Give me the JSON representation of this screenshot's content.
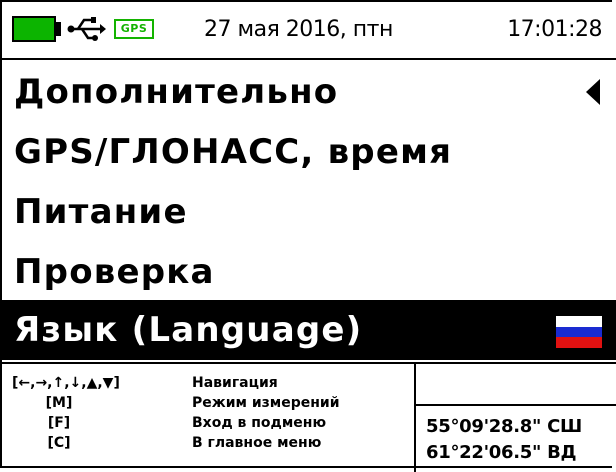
{
  "status_bar": {
    "battery": {
      "level": 1.0,
      "color": "#0cb400"
    },
    "connection_icon": "usb-icon",
    "gps_badge": "GPS",
    "date": "27 мая 2016, птн",
    "time": "17:01:28"
  },
  "menu": {
    "items": [
      {
        "label": "Дополнительно",
        "marker": "arrow-left-icon"
      },
      {
        "label": "GPS/ГЛОНАСС, время"
      },
      {
        "label": "Питание"
      },
      {
        "label": "Проверка"
      },
      {
        "label": "Язык (Language)",
        "selected": true,
        "icon": "russian-flag-icon"
      }
    ],
    "flag_colors": [
      "#ffffff",
      "#1a2bd1",
      "#e01111"
    ]
  },
  "help": {
    "rows": [
      {
        "key": "[←,→,↑,↓,▲,▼]",
        "desc": "Навигация"
      },
      {
        "key": "[M]",
        "desc": "Режим измерений"
      },
      {
        "key": "[F]",
        "desc": "Вход в подменю"
      },
      {
        "key": "[C]",
        "desc": "В главное меню"
      }
    ]
  },
  "coordinates": {
    "latitude": "55°09'28.8\" СШ",
    "longitude": "61°22'06.5\" ВД"
  }
}
